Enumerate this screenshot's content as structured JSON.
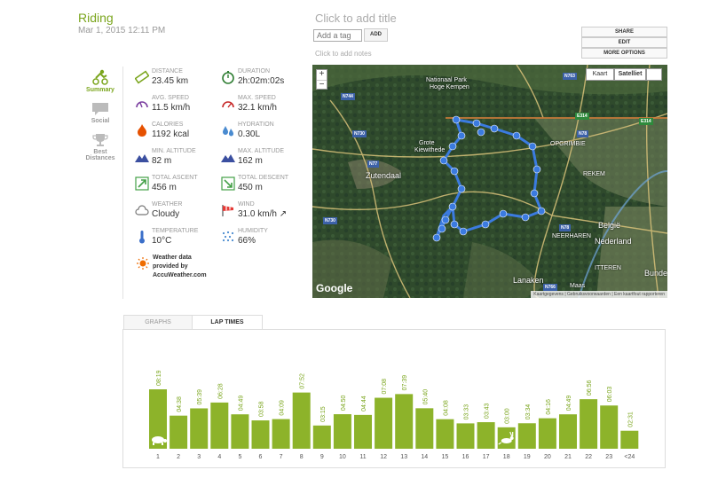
{
  "activity": {
    "title": "Riding",
    "date": "Mar 1, 2015 12:11 PM"
  },
  "editor": {
    "add_title": "Click to add title",
    "tag_placeholder": "Add a tag",
    "tag_button": "ADD",
    "add_notes": "Click to add notes"
  },
  "options": {
    "share": "SHARE",
    "edit": "EDIT",
    "more": "MORE OPTIONS"
  },
  "nav": {
    "summary": "Summary",
    "social": "Social",
    "best1": "Best",
    "best2": "Distances"
  },
  "stats": {
    "distance": {
      "label": "DISTANCE",
      "value": "23.45 km"
    },
    "duration": {
      "label": "DURATION",
      "value": "2h:02m:02s"
    },
    "avg_speed": {
      "label": "AVG. SPEED",
      "value": "11.5 km/h"
    },
    "max_speed": {
      "label": "MAX. SPEED",
      "value": "32.1 km/h"
    },
    "calories": {
      "label": "CALORIES",
      "value": "1192 kcal"
    },
    "hydration": {
      "label": "HYDRATION",
      "value": "0.30L"
    },
    "min_alt": {
      "label": "MIN. ALTITUDE",
      "value": "82 m"
    },
    "max_alt": {
      "label": "MAX. ALTITUDE",
      "value": "162 m"
    },
    "ascent": {
      "label": "TOTAL ASCENT",
      "value": "456 m"
    },
    "descent": {
      "label": "TOTAL DESCENT",
      "value": "450 m"
    },
    "weather": {
      "label": "WEATHER",
      "value": "Cloudy"
    },
    "wind": {
      "label": "WIND",
      "value": "31.0 km/h ↗"
    },
    "temperature": {
      "label": "TEMPERATURE",
      "value": "10°C"
    },
    "humidity": {
      "label": "HUMIDITY",
      "value": "66%"
    }
  },
  "weather_note": {
    "line1": "Weather data",
    "line2": "provided by",
    "line3": "AccuWeather.com"
  },
  "map": {
    "zoom_in": "+",
    "zoom_out": "−",
    "type_map": "Kaart",
    "type_satellite": "Satelliet",
    "footer_1": "Kaartgegevens",
    "footer_2": "Gebruiksvoorwaarden",
    "footer_3": "Een kaartfout rapporteren",
    "google": "Google",
    "labels": {
      "park1": "Nationaal Park",
      "park2": "Hoge Kempen",
      "town_zutendaal": "Zutendaal",
      "groote1": "Grote",
      "groote2": "Kiewithede",
      "opgrimbie": "OPGRIMBIE",
      "rekem": "REKEM",
      "neerharen": "NEERHAREN",
      "belgie": "België",
      "nederland": "Nederland",
      "itteren": "ITTEREN",
      "bunde": "Bunde",
      "lanaken": "Lanaken",
      "maas": "Maas"
    },
    "roads": {
      "n744": "N744",
      "n730": "N730",
      "n77": "N77",
      "n730b": "N730",
      "n763": "N763",
      "e314a": "E314",
      "e314b": "E314",
      "n78a": "N78",
      "n78b": "N78",
      "n766": "N766"
    }
  },
  "tabs": {
    "graphs": "GRAPHS",
    "lap_times": "LAP TIMES"
  },
  "colors": {
    "accent": "#7aa51c",
    "bar": "#8db32a",
    "route": "#3b7be0"
  },
  "chart_data": {
    "type": "bar",
    "title": "",
    "xlabel": "",
    "ylabel": "",
    "categories": [
      "1",
      "2",
      "3",
      "4",
      "5",
      "6",
      "7",
      "8",
      "9",
      "10",
      "11",
      "12",
      "13",
      "14",
      "15",
      "16",
      "17",
      "18",
      "19",
      "20",
      "21",
      "22",
      "23",
      "<24"
    ],
    "labels": [
      "08:19",
      "04:38",
      "05:39",
      "06:28",
      "04:49",
      "03:58",
      "04:09",
      "07:52",
      "03:15",
      "04:50",
      "04:44",
      "07:08",
      "07:39",
      "05:40",
      "04:08",
      "03:33",
      "03:43",
      "03:00",
      "03:34",
      "04:16",
      "04:49",
      "06:56",
      "06:03",
      "02:31"
    ],
    "values_seconds": [
      499,
      278,
      339,
      388,
      289,
      238,
      249,
      472,
      195,
      290,
      284,
      428,
      459,
      340,
      248,
      213,
      223,
      180,
      214,
      256,
      289,
      416,
      363,
      151
    ],
    "slowest_marker": "turtle-icon",
    "fastest_marker": "hare-icon",
    "ylim": [
      0,
      499
    ],
    "grid": false
  }
}
